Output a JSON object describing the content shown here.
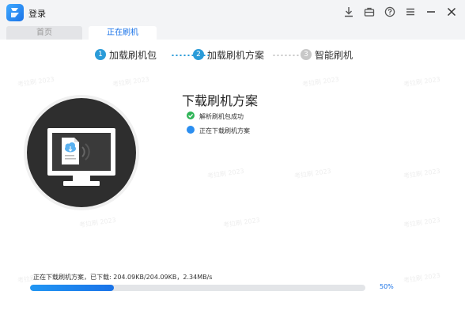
{
  "titlebar": {
    "login_label": "登录",
    "icons": [
      "download-icon",
      "briefcase-icon",
      "help-icon",
      "menu-icon",
      "minimize-icon",
      "close-icon"
    ]
  },
  "tabs": [
    {
      "label": "首页",
      "active": false
    },
    {
      "label": "正在刷机",
      "active": true
    }
  ],
  "steps": [
    {
      "num": "1",
      "label": "加载刷机包",
      "state": "done"
    },
    {
      "num": "2",
      "label": "加载刷机方案",
      "state": "active"
    },
    {
      "num": "3",
      "label": "智能刷机",
      "state": "pending"
    }
  ],
  "main": {
    "title": "下载刷机方案",
    "statuses": [
      {
        "text": "解析刷机包成功",
        "state": "success"
      },
      {
        "text": "正在下载刷机方案",
        "state": "in-progress"
      }
    ]
  },
  "progress": {
    "text": "正在下载刷机方案，已下载:  204.09KB/204.09KB，2.34MB/s",
    "percent_label": "50%",
    "fraction": 0.5
  },
  "colors": {
    "accent": "#1a73e8",
    "step_active": "#2a9bd8",
    "step_pending": "#c8c8c8",
    "success": "#2fb457",
    "info": "#2b8ef0",
    "illustration_bg": "#2e2e2e"
  }
}
